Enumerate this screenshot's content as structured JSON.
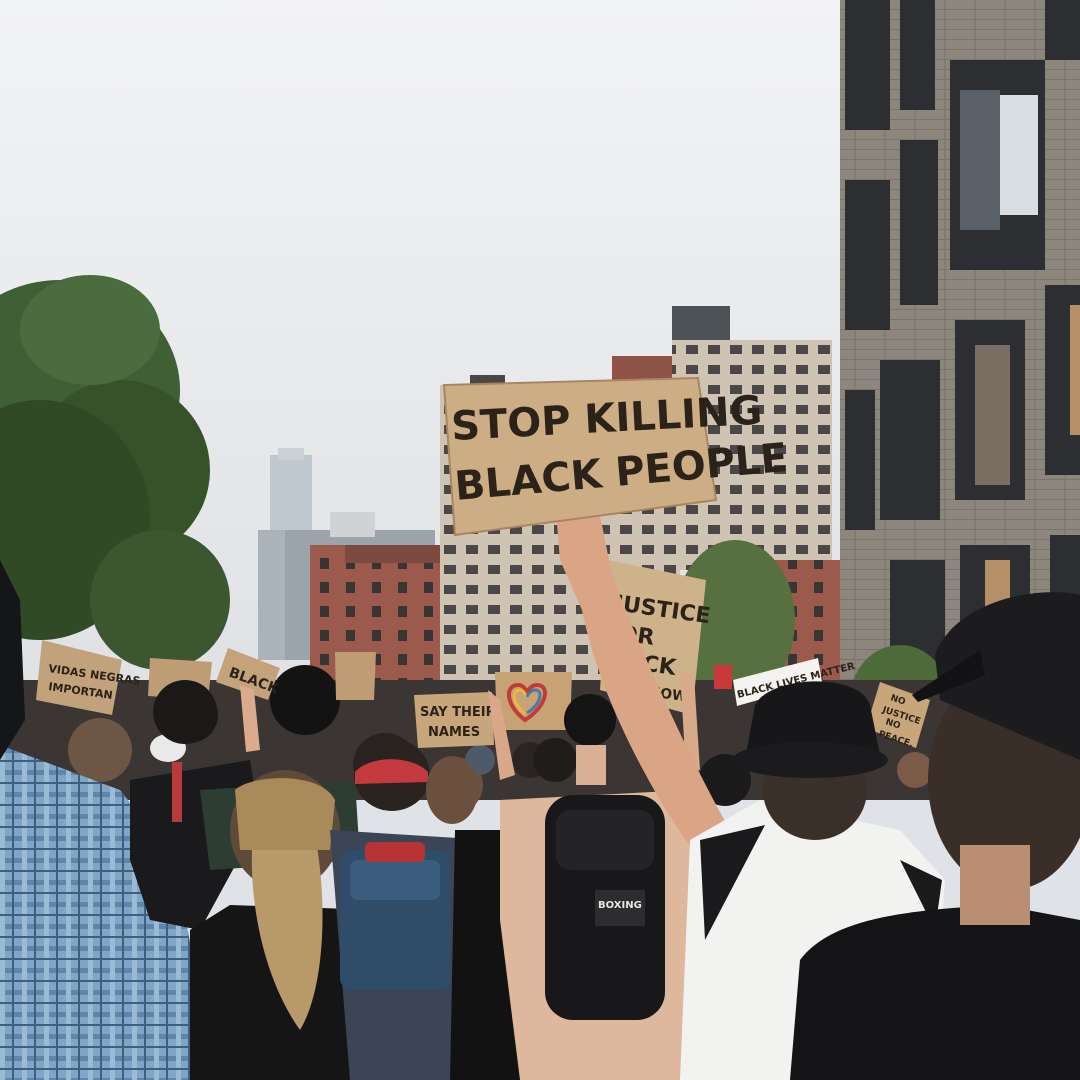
{
  "photo": {
    "colors": {
      "sky": "#e9ebee",
      "cardboard": "#c9a77b",
      "cardboard_dark": "#b8946a",
      "brick": "#9c5a4d",
      "tan_building": "#c9bfb0",
      "tree": "#3f5f34",
      "shirt_white": "#f2f2f0",
      "black": "#16171a",
      "plaid": "#7fa6c6"
    },
    "signs": {
      "main_line1": "STOP KILLING",
      "main_line2": "BLACK PEOPLE",
      "justice_line1": "JUSTICE",
      "justice_line2": "OR",
      "justice_line3": "ACK",
      "justice_line4": "NOW",
      "names_line1": "SAY THEIR",
      "names_line2": "NAMES",
      "peace_line1": "NO",
      "peace_line2": "JUSTICE",
      "peace_line3": "NO",
      "peace_line4": "PEACE.",
      "black_left": "BLACK",
      "left_far_line1": "VIDAS NEGRAS",
      "left_far_line2": "IMPORTAN",
      "black_right": "BLACK LIVES MATTER"
    },
    "backpack_text": "BOXING"
  }
}
